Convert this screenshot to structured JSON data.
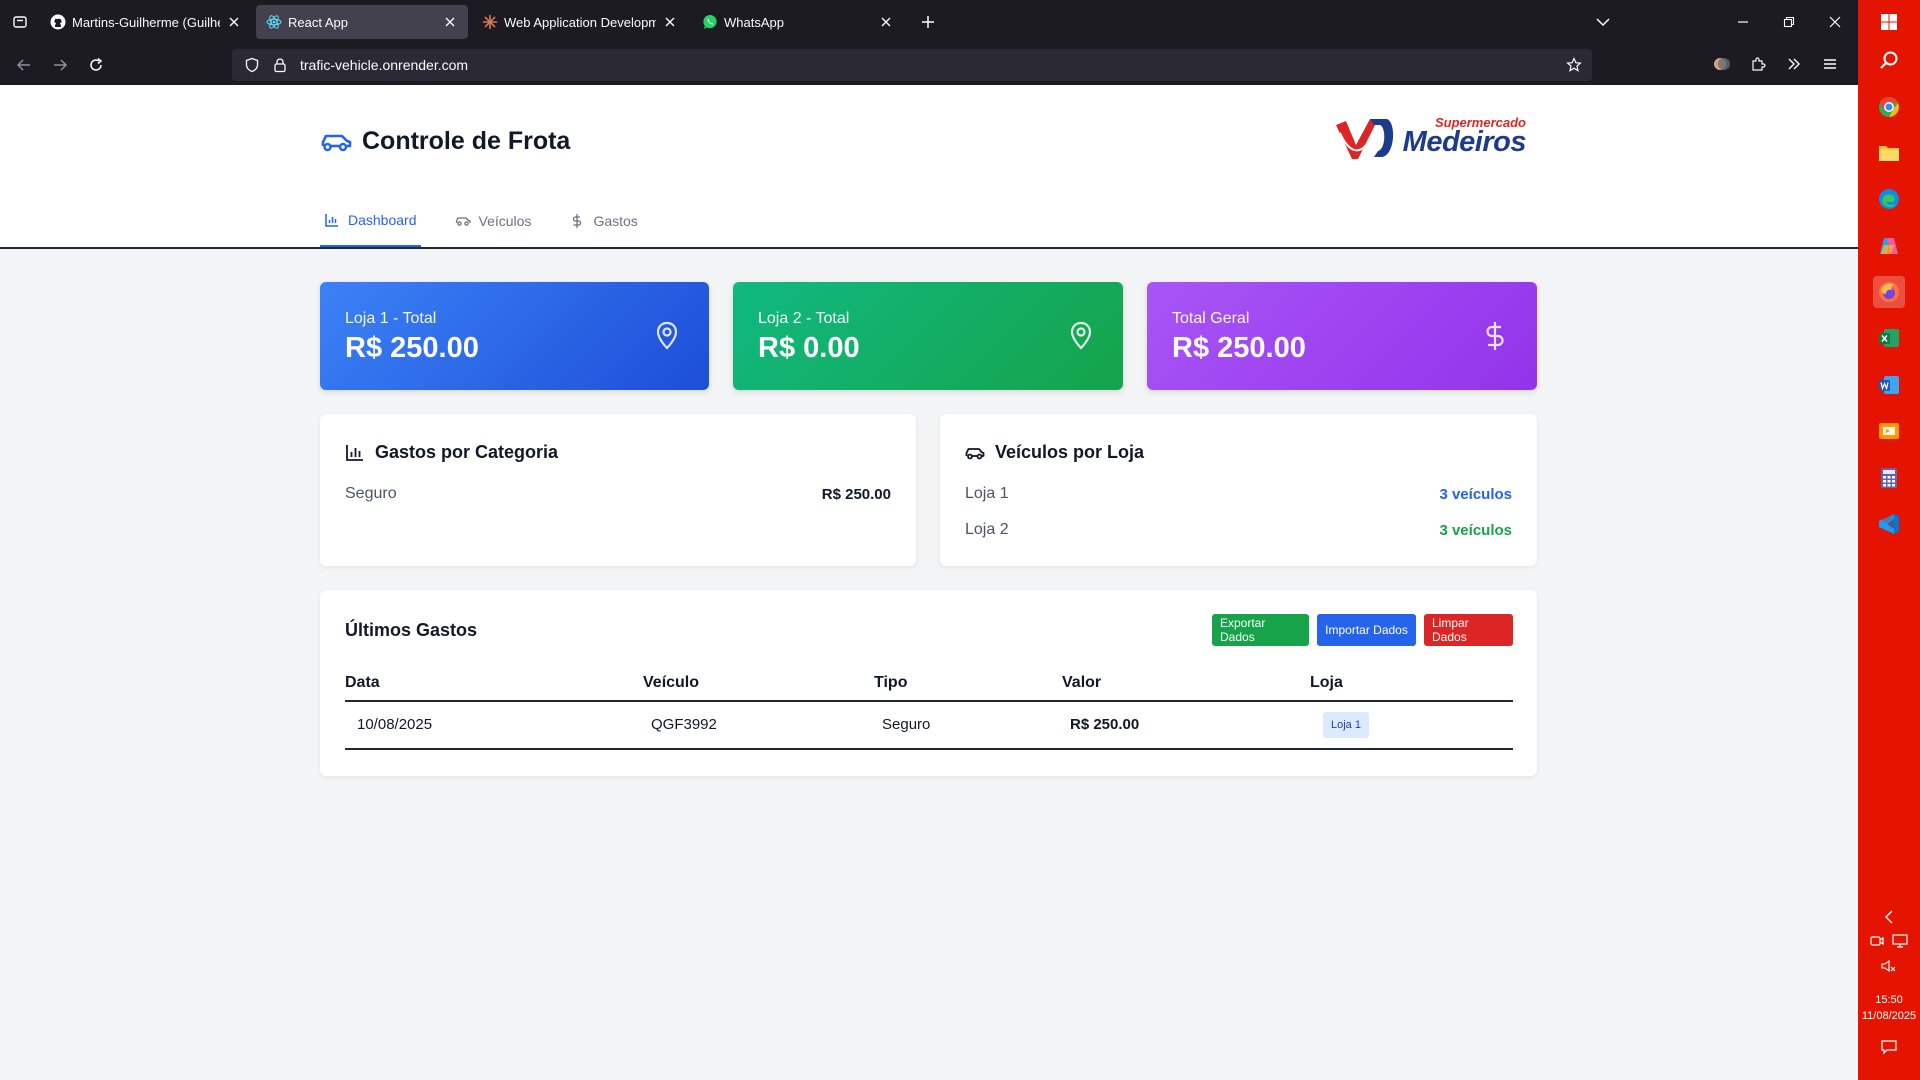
{
  "browser": {
    "tabs": [
      {
        "title": "Martins-Guilherme (Guilherme M",
        "icon": "github-icon",
        "active": false
      },
      {
        "title": "React App",
        "icon": "react-icon",
        "active": true
      },
      {
        "title": "Web Application Development",
        "icon": "claude-icon",
        "active": false
      },
      {
        "title": "WhatsApp",
        "icon": "whatsapp-icon",
        "active": false
      }
    ],
    "url": "trafic-vehicle.onrender.com"
  },
  "header": {
    "app_title": "Controle de Frota",
    "logo_top": "Supermercado",
    "logo_main": "Medeiros"
  },
  "nav": {
    "tabs": [
      {
        "label": "Dashboard",
        "active": true
      },
      {
        "label": "Veículos",
        "active": false
      },
      {
        "label": "Gastos",
        "active": false
      }
    ]
  },
  "summary": [
    {
      "label": "Loja 1 - Total",
      "amount": "R$ 250.00",
      "color": "#2563eb"
    },
    {
      "label": "Loja 2 - Total",
      "amount": "R$ 0.00",
      "color": "#16a34a"
    },
    {
      "label": "Total Geral",
      "amount": "R$ 250.00",
      "color": "#9333ea"
    }
  ],
  "category_panel": {
    "title": "Gastos por Categoria",
    "rows": [
      {
        "name": "Seguro",
        "value": "R$ 250.00"
      }
    ]
  },
  "vehicles_panel": {
    "title": "Veículos por Loja",
    "rows": [
      {
        "name": "Loja 1",
        "value": "3 veículos"
      },
      {
        "name": "Loja 2",
        "value": "3 veículos"
      }
    ]
  },
  "latest": {
    "title": "Últimos Gastos",
    "buttons": {
      "export": "Exportar Dados",
      "import": "Importar Dados",
      "clear": "Limpar Dados"
    },
    "columns": [
      "Data",
      "Veículo",
      "Tipo",
      "Valor",
      "Loja"
    ],
    "rows": [
      {
        "data": "10/08/2025",
        "veiculo": "QGF3992",
        "tipo": "Seguro",
        "valor": "R$ 250.00",
        "loja": "Loja 1"
      }
    ]
  },
  "taskbar": {
    "time": "15:50",
    "date": "11/08/2025"
  }
}
